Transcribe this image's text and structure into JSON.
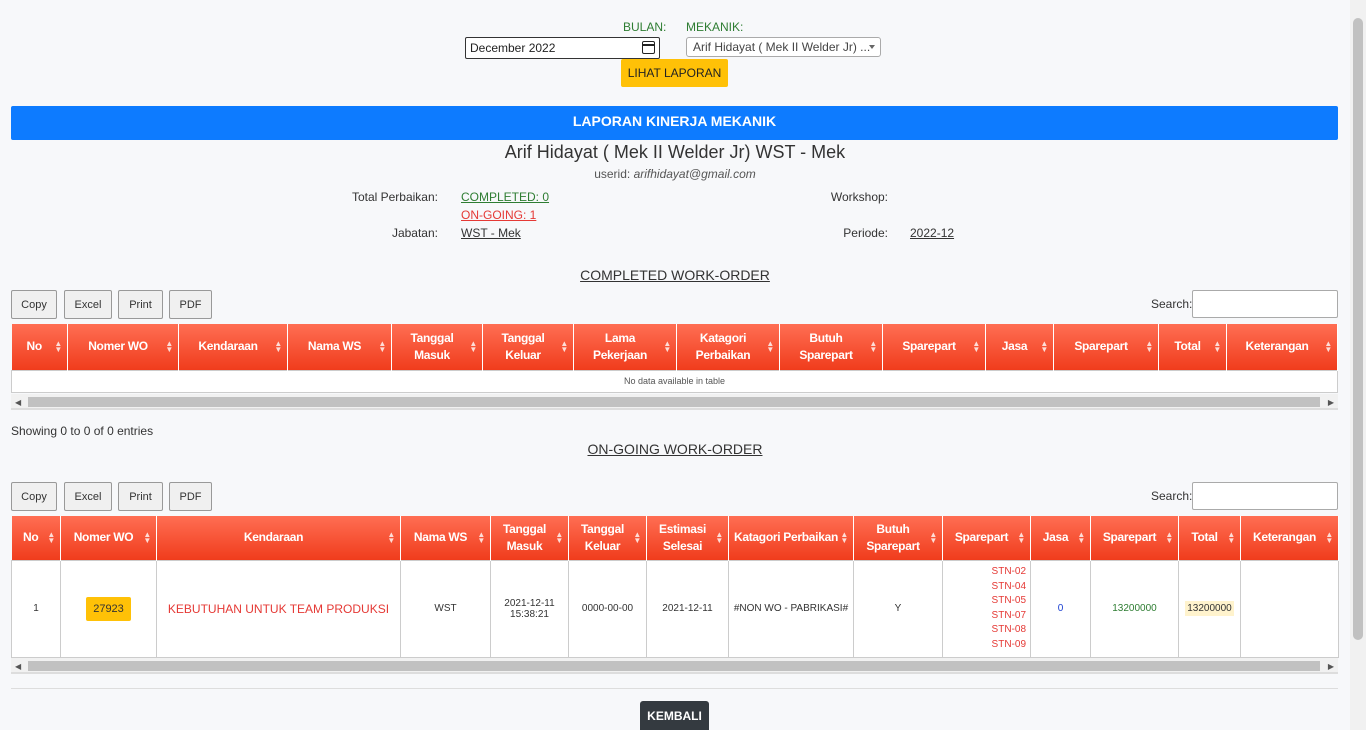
{
  "filter": {
    "bulan_label": "BULAN:",
    "mekanik_label": "MEKANIK:",
    "bulan_value": "December 2022",
    "mekanik_value": "Arif Hidayat ( Mek II Welder Jr) ...",
    "submit_label": "LIHAT LAPORAN"
  },
  "report": {
    "banner": "LAPORAN KINERJA MEKANIK",
    "mechanic_name": "Arif Hidayat ( Mek II Welder Jr) WST - Mek",
    "userid_label": "userid:",
    "userid_value": "arifhidayat@gmail.com",
    "total_perbaikan_label": "Total Perbaikan:",
    "completed_text": "COMPLETED: 0",
    "ongoing_text": "ON-GOING: 1",
    "jabatan_label": "Jabatan:",
    "jabatan_value": "WST - Mek",
    "workshop_label": "Workshop:",
    "workshop_value": "",
    "periode_label": "Periode:",
    "periode_value": "2022-12"
  },
  "toolbar": {
    "copy": "Copy",
    "excel": "Excel",
    "print": "Print",
    "pdf": "PDF",
    "search_label": "Search:"
  },
  "completed": {
    "title": "COMPLETED WORK-ORDER",
    "columns": [
      "No",
      "Nomer WO",
      "Kendaraan",
      "Nama WS",
      "Tanggal Masuk",
      "Tanggal Keluar",
      "Lama Pekerjaan",
      "Katagori Perbaikan",
      "Butuh Sparepart",
      "Sparepart",
      "Jasa",
      "Sparepart",
      "Total",
      "Keterangan"
    ],
    "empty_text": "No data available in table",
    "info": "Showing 0 to 0 of 0 entries"
  },
  "ongoing": {
    "title": "ON-GOING WORK-ORDER",
    "columns": [
      "No",
      "Nomer WO",
      "Kendaraan",
      "Nama WS",
      "Tanggal Masuk",
      "Tanggal Keluar",
      "Estimasi Selesai",
      "Katagori Perbaikan",
      "Butuh Sparepart",
      "Sparepart",
      "Jasa",
      "Sparepart",
      "Total",
      "Keterangan"
    ],
    "rows": [
      {
        "no": "1",
        "wo": "27923",
        "kendaraan": "KEBUTUHAN UNTUK TEAM PRODUKSI",
        "nama_ws": "WST",
        "tgl_masuk_date": "2021-12-11",
        "tgl_masuk_time": "15:38:21",
        "tgl_keluar": "0000-00-00",
        "estimasi": "2021-12-11",
        "kategori": "#NON WO - PABRIKASI#",
        "butuh": "Y",
        "spareparts": [
          "STN-02",
          "STN-04",
          "STN-05",
          "STN-07",
          "STN-08",
          "STN-09"
        ],
        "jasa": "0",
        "sparepart_cost": "13200000",
        "total": "13200000",
        "keterangan": ""
      }
    ]
  },
  "footer": {
    "back_label": "KEMBALI"
  },
  "colors": {
    "banner": "#0d7bff",
    "table_header": "#f03c1c",
    "button": "#ffc107"
  }
}
